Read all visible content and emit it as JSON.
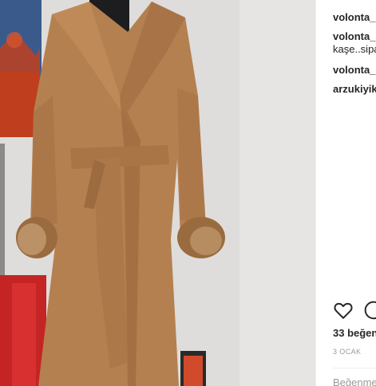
{
  "post": {
    "image_alt_icon": "coat-photo",
    "comments": [
      {
        "user": "volonta_",
        "text": ""
      },
      {
        "user": "volonta_",
        "text": "kaşe..sipa"
      },
      {
        "user": "volonta_",
        "text": ""
      },
      {
        "user": "arzukiyik",
        "text": ""
      }
    ],
    "actions": {
      "like_icon": "heart-icon",
      "comment_icon": "comment-icon"
    },
    "likes_text": "33 beğen",
    "date_text": "3 OCAK",
    "add_comment_placeholder": "Beğenme"
  },
  "colors": {
    "accent_text": "#262626",
    "muted_text": "#999999",
    "coat": "#b8814e",
    "background": "#ffffff"
  }
}
